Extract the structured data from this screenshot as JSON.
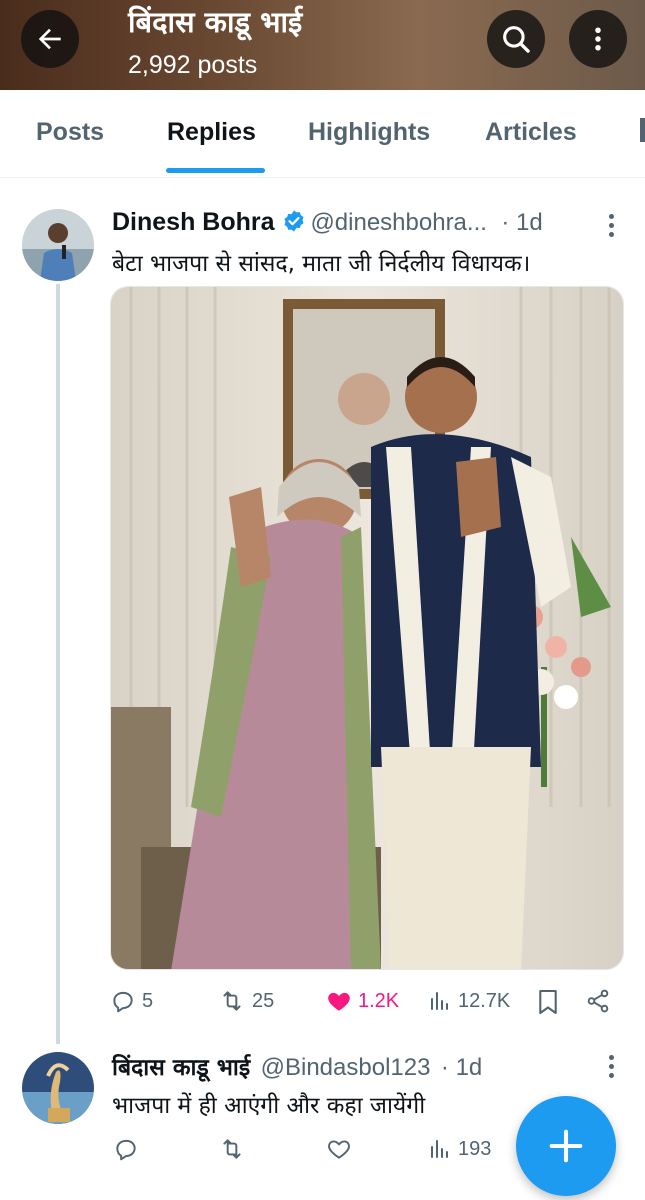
{
  "header": {
    "title": "बिंदास काडू भाई",
    "post_count": "2,992 posts",
    "back_icon": "arrow-left-icon",
    "search_icon": "search-icon",
    "more_icon": "more-vertical-icon"
  },
  "tabs": [
    {
      "label": "Posts",
      "active": false
    },
    {
      "label": "Replies",
      "active": true
    },
    {
      "label": "Highlights",
      "active": false
    },
    {
      "label": "Articles",
      "active": false
    }
  ],
  "tweets": [
    {
      "name": "Dinesh Bohra",
      "verified": true,
      "handle": "@dineshbohra...",
      "time": "· 1d",
      "text": "बेटा भाजपा से सांसद, माता जी निर्दलीय विधायक।",
      "replies": "5",
      "reposts": "25",
      "likes": "1.2K",
      "liked": true,
      "views": "12.7K"
    },
    {
      "name": "बिंदास काडू भाई",
      "verified": false,
      "handle": "@Bindasbol123",
      "time": "· 1d",
      "text": "भाजपा में ही आएंगी और कहा जायेंगी",
      "replies": "",
      "reposts": "",
      "likes": "",
      "liked": false,
      "views": "193"
    }
  ],
  "colors": {
    "accent": "#1d9bf0",
    "like": "#f91880",
    "secondary_text": "#536471"
  },
  "fab": {
    "icon": "plus-icon"
  }
}
